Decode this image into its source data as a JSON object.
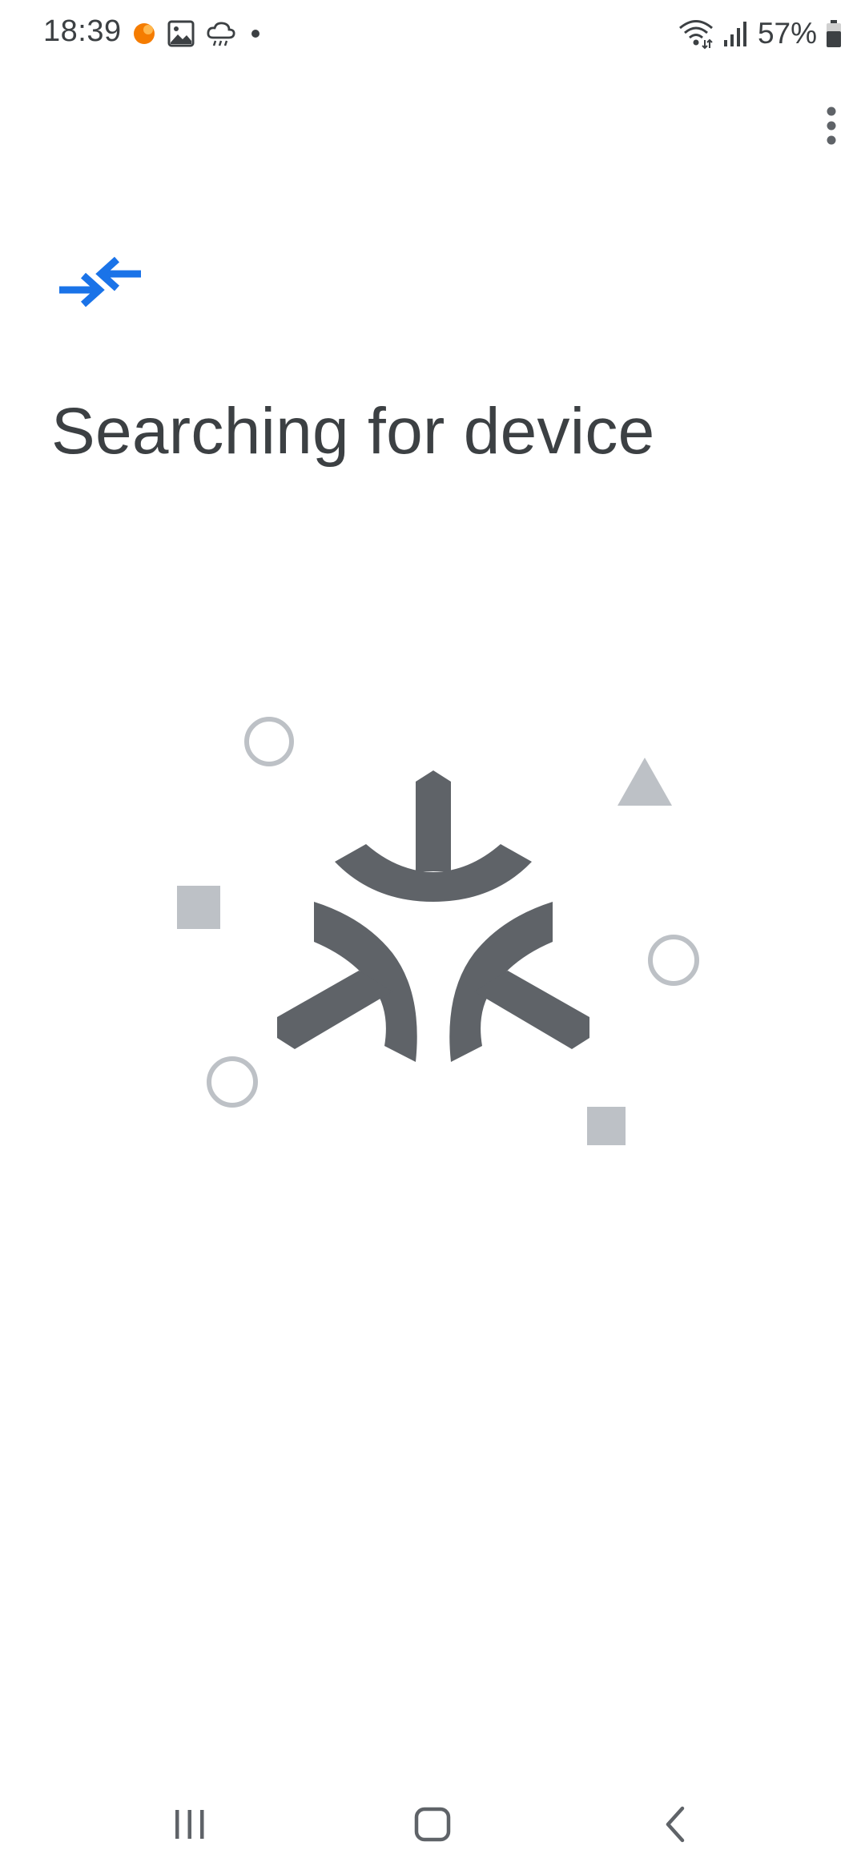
{
  "status_bar": {
    "time": "18:39",
    "battery_percent": "57%",
    "left_icons": [
      "notification-dot-orange-icon",
      "image-icon",
      "cloud-rain-icon",
      "dot-icon"
    ],
    "right_icons": [
      "wifi-icon",
      "signal-icon",
      "battery-icon"
    ]
  },
  "app_bar": {
    "overflow_icon": "more-vert-icon"
  },
  "header": {
    "icon": "connect-arrows-icon",
    "title": "Searching for device"
  },
  "illustration": {
    "icon": "matter-logo-icon",
    "decorations": [
      "circle-icon",
      "triangle-icon",
      "square-icon",
      "circle-icon",
      "circle-icon",
      "square-icon"
    ]
  },
  "nav_bar": {
    "buttons": [
      "recent-apps",
      "home",
      "back"
    ]
  },
  "colors": {
    "accent": "#1a73e8",
    "logo": "#5f6368",
    "decoration": "#bdc1c6",
    "text": "#3c4043"
  }
}
